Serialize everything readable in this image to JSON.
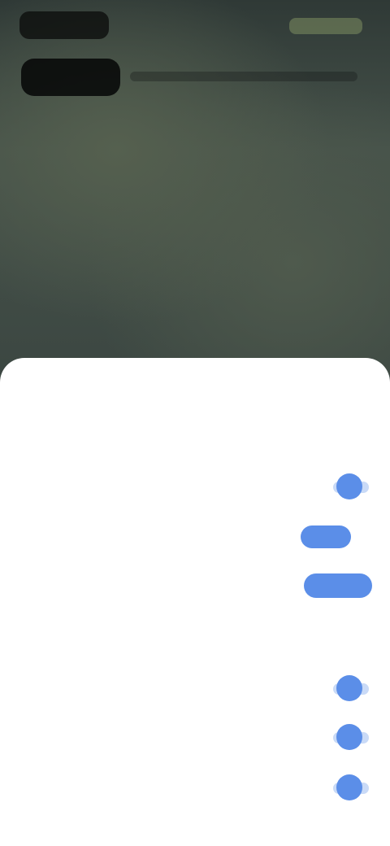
{
  "top_bar": {
    "pill_label": ""
  },
  "header": {
    "title": ""
  },
  "sheet": {
    "title": "",
    "rows": [
      {
        "label": "",
        "control": "none"
      },
      {
        "label": "",
        "control": "toggle",
        "on": true
      },
      {
        "label": "",
        "control": "segmented",
        "options": [
          "",
          "",
          ""
        ],
        "selected_index": 1
      },
      {
        "label": "",
        "control": "segmented",
        "options": [
          "",
          ""
        ],
        "selected_index": 1
      },
      {
        "label": "",
        "control": "none"
      },
      {
        "label": "",
        "control": "toggle",
        "on": true
      },
      {
        "label": "",
        "control": "toggle",
        "on": true
      },
      {
        "label": "",
        "control": "toggle",
        "on": true
      }
    ]
  },
  "colors": {
    "accent": "#5b8ee8",
    "accent_light": "#c9daf7",
    "sheet_bg": "#ffffff"
  }
}
